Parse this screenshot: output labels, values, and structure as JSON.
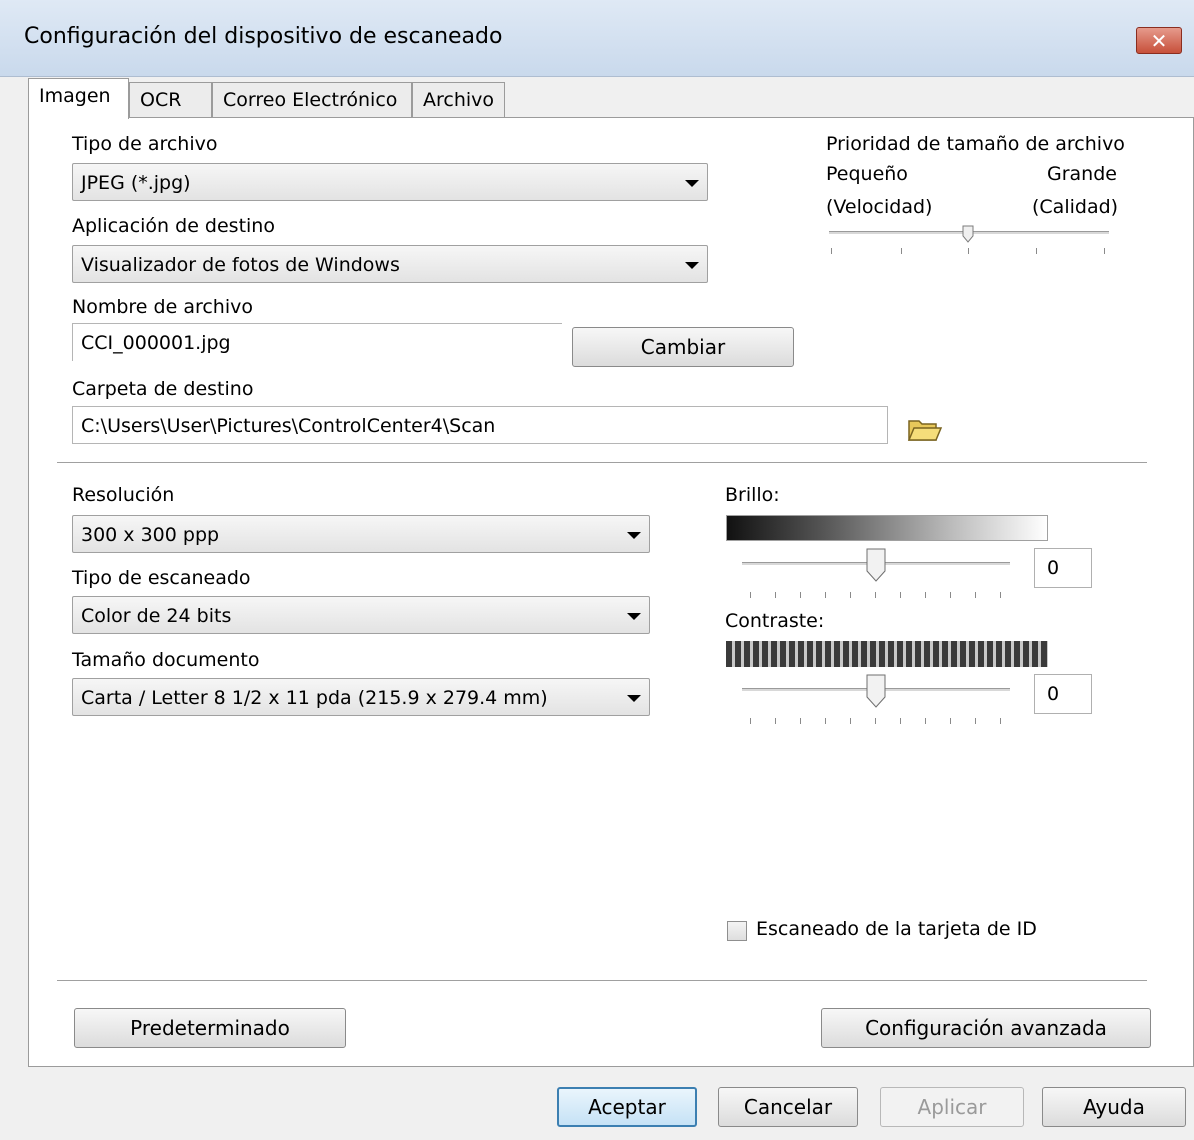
{
  "window": {
    "title": "Configuración del dispositivo de escaneado",
    "close_label": "✕"
  },
  "tabs": [
    {
      "label": "Imagen",
      "active": true
    },
    {
      "label": "OCR"
    },
    {
      "label": "Correo Electrónico"
    },
    {
      "label": "Archivo"
    }
  ],
  "file_type": {
    "label": "Tipo de archivo",
    "value": "JPEG (*.jpg)"
  },
  "target_app": {
    "label": "Aplicación de destino",
    "value": "Visualizador de fotos de Windows"
  },
  "file_name": {
    "label": "Nombre de archivo",
    "value": "CCI_000001.jpg",
    "change_button": "Cambiar"
  },
  "dest_folder": {
    "label": "Carpeta de destino",
    "value": "C:\\Users\\User\\Pictures\\ControlCenter4\\Scan",
    "browse_icon": "folder-icon"
  },
  "file_size_priority": {
    "title": "Prioridad de tamaño de archivo",
    "left_label": "Pequeño",
    "left_sub": "(Velocidad)",
    "right_label": "Grande",
    "right_sub": "(Calidad)",
    "level": 0.5
  },
  "resolution": {
    "label": "Resolución",
    "value": "300 x 300 ppp"
  },
  "scan_type": {
    "label": "Tipo de escaneado",
    "value": "Color de 24 bits"
  },
  "doc_size": {
    "label": "Tamaño documento",
    "value": "Carta / Letter 8 1/2 x 11 pda (215.9 x 279.4 mm)"
  },
  "brightness": {
    "label": "Brillo:",
    "value": "0"
  },
  "contrast": {
    "label": "Contraste:",
    "value": "0"
  },
  "id_card": {
    "label": "Escaneado de la tarjeta de ID",
    "checked": false
  },
  "buttons": {
    "default": "Predeterminado",
    "advanced": "Configuración avanzada",
    "ok": "Aceptar",
    "cancel": "Cancelar",
    "apply": "Aplicar",
    "help": "Ayuda"
  },
  "colors": {
    "accent": "#3c7fb1",
    "close": "#c7503a"
  }
}
